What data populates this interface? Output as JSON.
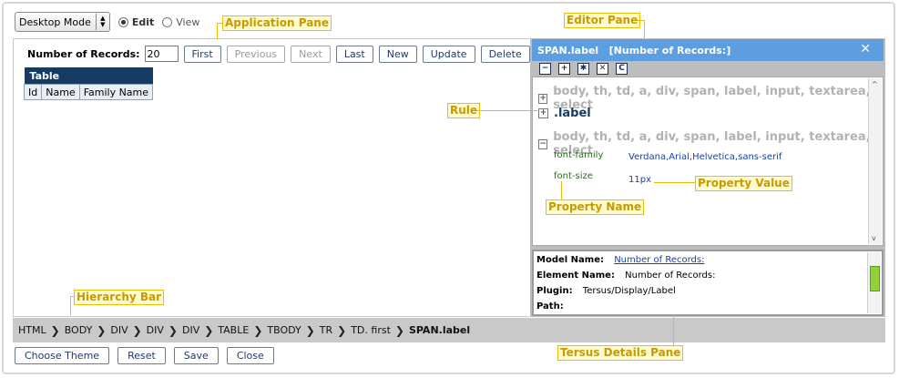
{
  "toolbar": {
    "mode_label": "Desktop Mode",
    "edit_label": "Edit",
    "view_label": "View"
  },
  "app": {
    "records_label": "Number of Records:",
    "records_value": "20",
    "buttons": [
      "First",
      "Previous",
      "Next",
      "Last",
      "New",
      "Update",
      "Delete"
    ],
    "table_title": "Table",
    "columns": [
      "Id",
      "Name",
      "Family Name"
    ]
  },
  "annotations": {
    "application_pane": "Application Pane",
    "editor_pane": "Editor Pane",
    "rule": "Rule",
    "property_value": "Property Value",
    "property_name": "Property Name",
    "hierarchy_bar": "Hierarchy Bar",
    "details_pane": "Tersus Details Pane"
  },
  "editor": {
    "title": "SPAN.label   [Number of Records:]",
    "close_glyph": "✕",
    "tools": [
      "−",
      "+",
      "✱",
      "✕",
      "C"
    ],
    "rules": [
      "body, th, td, a, div, span, label, input, textarea, select",
      ".label",
      "body, th, td, a, div, span, label, input, textarea, select"
    ],
    "properties": [
      {
        "name": "font-family",
        "value": "Verdana,Arial,Helvetica,sans-serif"
      },
      {
        "name": "font-size",
        "value": "11px"
      }
    ]
  },
  "details": {
    "model_name_label": "Model Name:",
    "model_name_value": "Number of Records:",
    "element_name_label": "Element Name:",
    "element_name_value": "Number of Records:",
    "plugin_label": "Plugin:",
    "plugin_value": "Tersus/Display/Label",
    "path_label": "Path:"
  },
  "hierarchy": [
    "HTML",
    "BODY",
    "DIV",
    "DIV",
    "DIV",
    "TABLE",
    "TBODY",
    "TR",
    "TD. first",
    "SPAN.label"
  ],
  "bottom_buttons": [
    "Choose Theme",
    "Reset",
    "Save",
    "Close"
  ]
}
